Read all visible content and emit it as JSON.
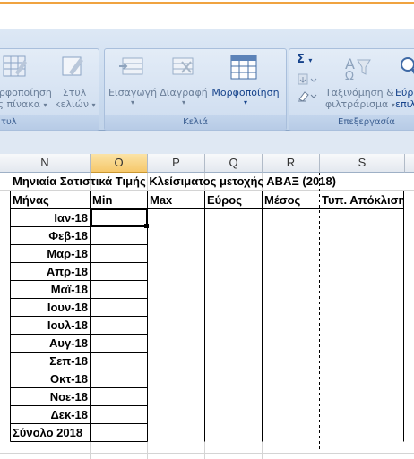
{
  "ribbon": {
    "partial_group1": {
      "btn1_line1": "ορφοποίηση",
      "btn1_line2": "ς πίνακα",
      "btn2_line1": "Στυλ",
      "btn2_line2": "κελιών",
      "label": "τυλ"
    },
    "cells_group": {
      "label": "Κελιά",
      "insert": "Εισαγωγή",
      "delete": "Διαγραφή",
      "format": "Μορφοποίηση"
    },
    "editing_group": {
      "label": "Επεξεργασία",
      "sigma": "Σ",
      "sort_line1": "Ταξινόμηση &",
      "sort_line2": "φιλτράρισμα",
      "find_line1": "Εύρ",
      "find_line2": "επιλ"
    }
  },
  "columns": [
    "N",
    "O",
    "P",
    "Q",
    "R",
    "S"
  ],
  "selected_column": "O",
  "sheet": {
    "title": "Μηνιαία Σατιστικά Τιμής Κλείσιματος μετοχής ΑΒΑΞ (2018)",
    "headers": [
      "Μήνας",
      "Min",
      "Max",
      "Εύρος",
      "Μέσος",
      "Τυπ. Απόκλιση"
    ],
    "months": [
      "Ιαν-18",
      "Φεβ-18",
      "Μαρ-18",
      "Απρ-18",
      "Μαϊ-18",
      "Ιουν-18",
      "Ιουλ-18",
      "Αυγ-18",
      "Σεπ-18",
      "Οκτ-18",
      "Νοε-18",
      "Δεκ-18"
    ],
    "total_label": "Σύνολο 2018"
  }
}
